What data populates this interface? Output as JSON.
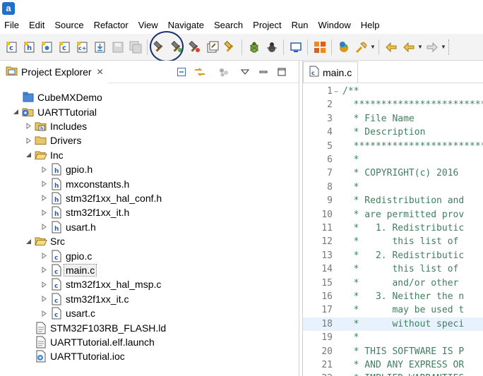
{
  "menu": [
    "File",
    "Edit",
    "Source",
    "Refactor",
    "View",
    "Navigate",
    "Search",
    "Project",
    "Run",
    "Window",
    "Help"
  ],
  "toolbar": {
    "buttons": [
      "new-source-folder",
      "new-header-file",
      "new-class",
      "new-c-file",
      "new-cpp-file",
      "import",
      "save",
      "save-all",
      "build",
      "build-debug",
      "build-release",
      "build-all",
      "clean",
      "debug",
      "debug-config",
      "open-console",
      "tree-view",
      "external-tools",
      "run-last",
      "prev-annotation",
      "back",
      "forward"
    ]
  },
  "explorer": {
    "title": "Project Explorer",
    "items": [
      {
        "label": "CubeMXDemo",
        "level": 0,
        "twist": "",
        "icon": "project-closed-icon"
      },
      {
        "label": "UARTTutorial",
        "level": 0,
        "twist": "open",
        "icon": "project-open-icon"
      },
      {
        "label": "Includes",
        "level": 1,
        "twist": "closed",
        "icon": "includes-icon"
      },
      {
        "label": "Drivers",
        "level": 1,
        "twist": "closed",
        "icon": "folder-icon"
      },
      {
        "label": "Inc",
        "level": 1,
        "twist": "open",
        "icon": "folder-open-icon"
      },
      {
        "label": "gpio.h",
        "level": 2,
        "twist": "closed",
        "icon": "header-file-icon"
      },
      {
        "label": "mxconstants.h",
        "level": 2,
        "twist": "closed",
        "icon": "header-file-icon"
      },
      {
        "label": "stm32f1xx_hal_conf.h",
        "level": 2,
        "twist": "closed",
        "icon": "header-file-icon"
      },
      {
        "label": "stm32f1xx_it.h",
        "level": 2,
        "twist": "closed",
        "icon": "header-file-icon"
      },
      {
        "label": "usart.h",
        "level": 2,
        "twist": "closed",
        "icon": "header-file-icon"
      },
      {
        "label": "Src",
        "level": 1,
        "twist": "open",
        "icon": "folder-open-icon"
      },
      {
        "label": "gpio.c",
        "level": 2,
        "twist": "closed",
        "icon": "c-file-icon"
      },
      {
        "label": "main.c",
        "level": 2,
        "twist": "closed",
        "icon": "c-file-icon",
        "selected": true
      },
      {
        "label": "stm32f1xx_hal_msp.c",
        "level": 2,
        "twist": "closed",
        "icon": "c-file-icon"
      },
      {
        "label": "stm32f1xx_it.c",
        "level": 2,
        "twist": "closed",
        "icon": "c-file-icon"
      },
      {
        "label": "usart.c",
        "level": 2,
        "twist": "closed",
        "icon": "c-file-icon"
      },
      {
        "label": "STM32F103RB_FLASH.ld",
        "level": 1,
        "twist": "",
        "icon": "text-file-icon"
      },
      {
        "label": "UARTTutorial.elf.launch",
        "level": 1,
        "twist": "",
        "icon": "text-file-icon"
      },
      {
        "label": "UARTTutorial.ioc",
        "level": 1,
        "twist": "",
        "icon": "ioc-file-icon"
      }
    ]
  },
  "editor": {
    "tab_label": "main.c",
    "current_line": 18,
    "lines": [
      {
        "n": "1",
        "text": "/**",
        "fold": "−"
      },
      {
        "n": "2",
        "text": "  ******************************"
      },
      {
        "n": "3",
        "text": "  * File Name"
      },
      {
        "n": "4",
        "text": "  * Description"
      },
      {
        "n": "5",
        "text": "  ******************************"
      },
      {
        "n": "6",
        "text": "  *"
      },
      {
        "n": "7",
        "text": "  * COPYRIGHT(c) 2016"
      },
      {
        "n": "8",
        "text": "  *"
      },
      {
        "n": "9",
        "text": "  * Redistribution and"
      },
      {
        "n": "10",
        "text": "  * are permitted prov"
      },
      {
        "n": "11",
        "text": "  *   1. Redistributic"
      },
      {
        "n": "12",
        "text": "  *      this list of"
      },
      {
        "n": "13",
        "text": "  *   2. Redistributic"
      },
      {
        "n": "14",
        "text": "  *      this list of"
      },
      {
        "n": "15",
        "text": "  *      and/or other"
      },
      {
        "n": "16",
        "text": "  *   3. Neither the n"
      },
      {
        "n": "17",
        "text": "  *      may be used t"
      },
      {
        "n": "18",
        "text": "  *      without speci"
      },
      {
        "n": "19",
        "text": "  *"
      },
      {
        "n": "20",
        "text": "  * THIS SOFTWARE IS P"
      },
      {
        "n": "21",
        "text": "  * AND ANY EXPRESS OR"
      },
      {
        "n": "22",
        "text": "  * IMPLIED WARRANTIES"
      }
    ]
  },
  "colors": {
    "comment": "#3f7f5f",
    "line_number": "#787878",
    "highlight_ring": "#1a2f6e",
    "current_line_bg": "#e8f2fe"
  }
}
